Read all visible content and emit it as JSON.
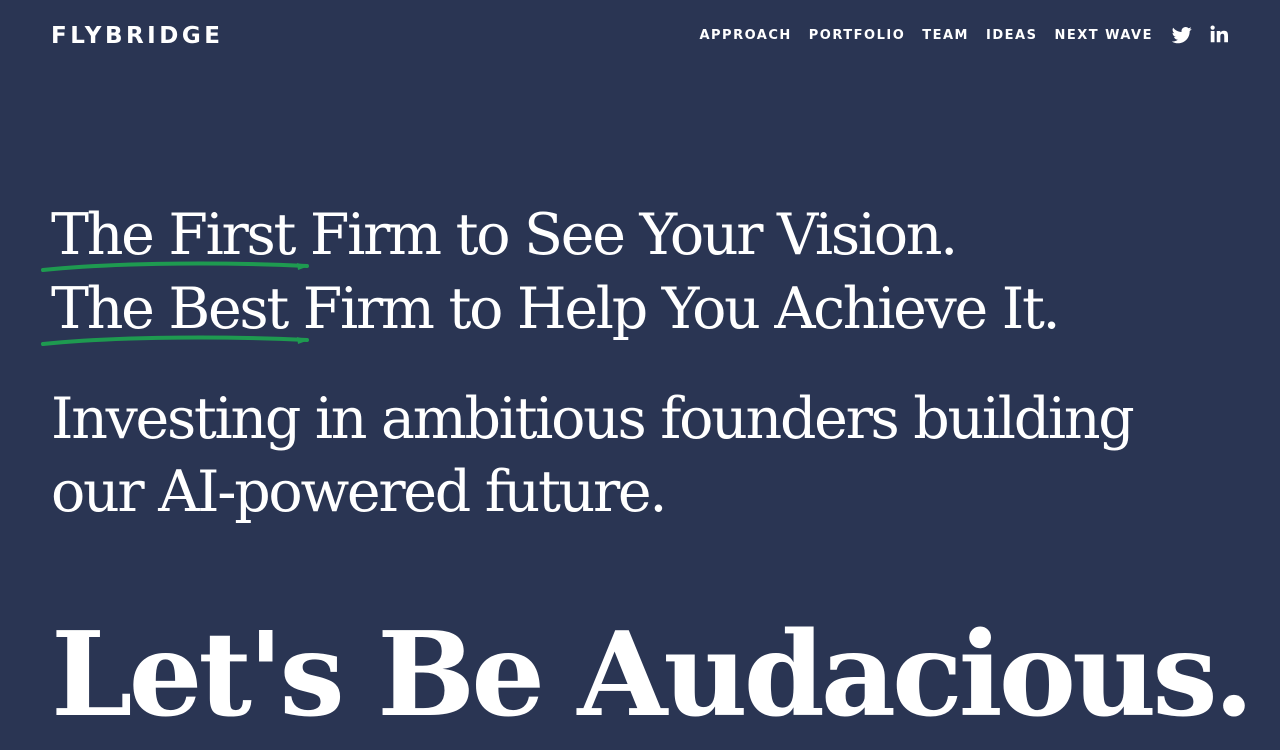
{
  "brand": {
    "logo_text": "FLYBRIDGE"
  },
  "nav": {
    "items": [
      {
        "label": "APPROACH"
      },
      {
        "label": "PORTFOLIO"
      },
      {
        "label": "TEAM"
      },
      {
        "label": "IDEAS"
      },
      {
        "label": "NEXT WAVE"
      }
    ]
  },
  "social": {
    "icons": [
      "twitter-icon",
      "linkedin-icon"
    ]
  },
  "hero": {
    "line1_highlight": "The First",
    "line1_rest": " Firm to See Your Vision.",
    "line2_highlight": "The Best",
    "line2_rest": " Firm to Help You Achieve It.",
    "mission": "Investing in ambitious founders building our AI-powered future.",
    "slogan": "Let's Be Audacious."
  },
  "colors": {
    "background": "#2a3553",
    "text": "#ffffff",
    "underline_accent": "#1e9a50"
  }
}
